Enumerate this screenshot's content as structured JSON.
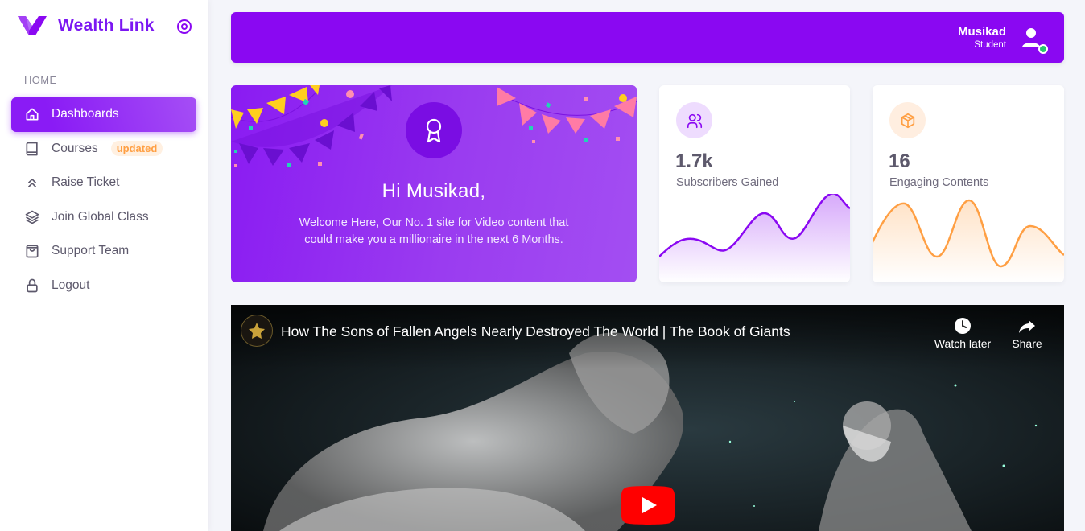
{
  "brand": {
    "name": "Wealth Link",
    "icons": {
      "logo": "brand-logo-v",
      "toggle": "target-circle-icon"
    }
  },
  "sidebar": {
    "section_header": "HOME",
    "items": [
      {
        "label": "Dashboards",
        "icon": "home-icon",
        "active": true
      },
      {
        "label": "Courses",
        "icon": "book-icon",
        "badge": "updated"
      },
      {
        "label": "Raise Ticket",
        "icon": "chevrons-up-icon"
      },
      {
        "label": "Join Global Class",
        "icon": "layers-icon"
      },
      {
        "label": "Support Team",
        "icon": "shopping-bag-icon"
      },
      {
        "label": "Logout",
        "icon": "lock-icon"
      }
    ]
  },
  "navbar": {
    "user_name": "Musikad",
    "user_role": "Student",
    "status": "online",
    "icons": {
      "avatar": "user-icon"
    }
  },
  "welcome": {
    "title": "Hi Musikad,",
    "text": "Welcome Here, Our No. 1 site for Video content that could make you a millionaire in the next 6 Months.",
    "icon": "award-icon"
  },
  "stats": [
    {
      "value": "1.7k",
      "label": "Subscribers Gained",
      "icon": "users-icon",
      "color": "#8a08f2"
    },
    {
      "value": "16",
      "label": "Engaging Contents",
      "icon": "package-icon",
      "color": "#ff9f43"
    }
  ],
  "video": {
    "title": "How The Sons of Fallen Angels Nearly Destroyed The World | The Book of Giants",
    "watch_later": "Watch later",
    "share": "Share",
    "icons": {
      "watch_later": "clock-icon",
      "share": "share-arrow-icon",
      "play": "play-button-icon",
      "channel": "channel-logo"
    }
  },
  "colors": {
    "primary": "#8a08f2",
    "accent_orange": "#ff9f43",
    "online": "#28c76f"
  }
}
